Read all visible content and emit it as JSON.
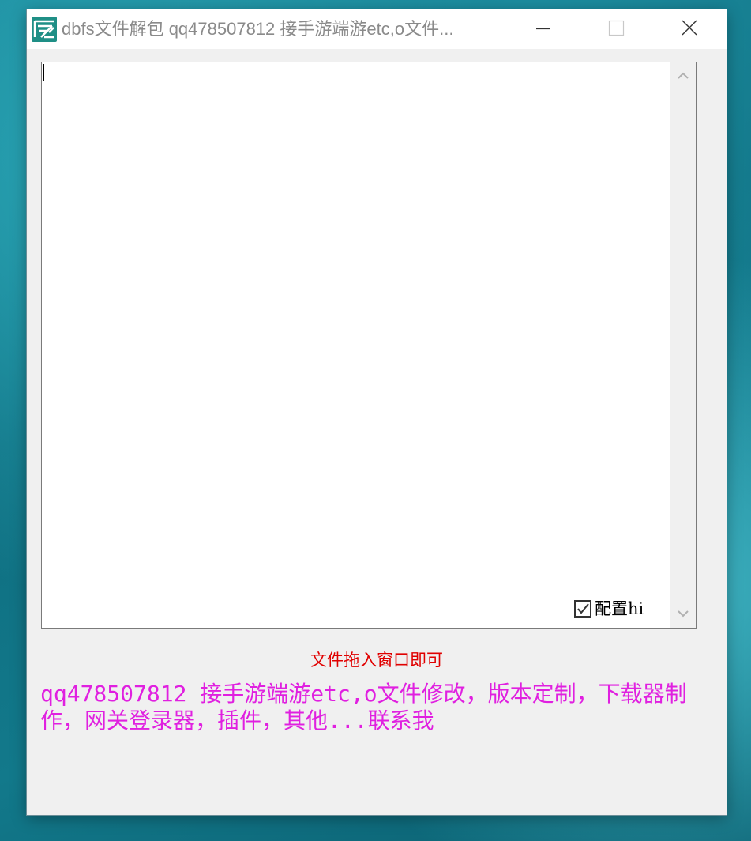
{
  "window": {
    "title": "dbfs文件解包 qq478507812 接手游端游etc,o文件..."
  },
  "titlebar_buttons": {
    "minimize_icon": "minimize-icon",
    "maximize_icon": "maximize-icon",
    "close_icon": "close-icon"
  },
  "editor": {
    "value": ""
  },
  "checkbox": {
    "label": "配置hi",
    "checked": true
  },
  "hint_text": "文件拖入窗口即可",
  "contact_text": "qq478507812 接手游端游etc,o文件修改，版本定制，下载器制作，网关登录器，插件，其他...联系我",
  "colors": {
    "hint": "#e00000",
    "contact": "#e020e0",
    "window_bg": "#f0f0f0",
    "icon_teal": "#1f8f86"
  }
}
